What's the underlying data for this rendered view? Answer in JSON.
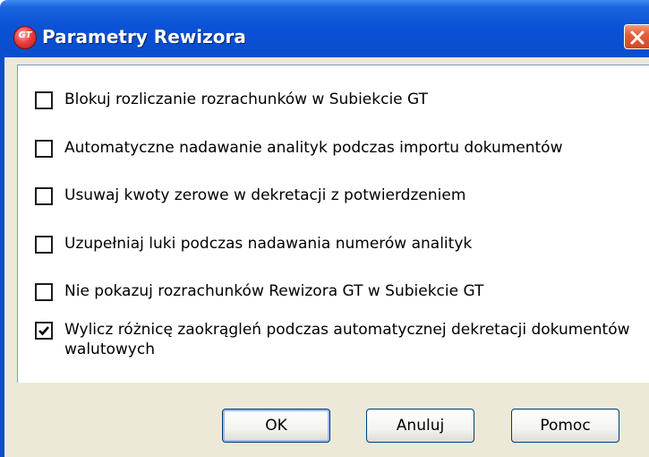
{
  "window": {
    "title": "Parametry Rewizora",
    "app_icon": "gt-logo-icon",
    "app_icon_text": "GT",
    "close_icon": "close-icon"
  },
  "options": [
    {
      "label": "Blokuj rozliczanie rozrachunków w Subiekcie GT",
      "checked": false
    },
    {
      "label": "Automatyczne nadawanie analityk podczas importu dokumentów",
      "checked": false
    },
    {
      "label": "Usuwaj kwoty zerowe w dekretacji z potwierdzeniem",
      "checked": false
    },
    {
      "label": "Uzupełniaj luki podczas nadawania numerów analityk",
      "checked": false
    },
    {
      "label": "Nie pokazuj rozrachunków Rewizora GT w Subiekcie GT",
      "checked": false
    },
    {
      "label": "Wylicz różnicę zaokrągleń podczas automatycznej dekretacji dokumentów walutowych",
      "checked": true
    }
  ],
  "buttons": {
    "ok": "OK",
    "cancel": "Anuluj",
    "help": "Pomoc"
  },
  "colors": {
    "titlebar": "#0a4fd1",
    "dialog_background": "#ece9d8",
    "close_button": "#d04a26"
  }
}
